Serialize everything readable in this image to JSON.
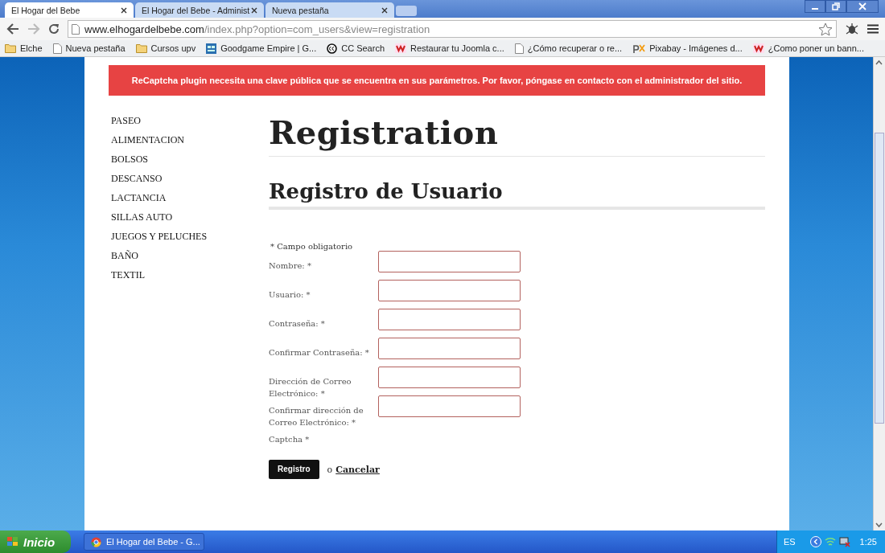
{
  "browser": {
    "tabs": [
      {
        "title": "El Hogar del Bebe",
        "selected": true
      },
      {
        "title": "El Hogar del Bebe - Administ",
        "selected": false
      },
      {
        "title": "Nueva pestaña",
        "selected": false
      }
    ],
    "url_host": "www.elhogardelbebe.com",
    "url_path": "/index.php?option=com_users&view=registration",
    "bookmarks": [
      {
        "label": "Elche",
        "kind": "folder"
      },
      {
        "label": "Nueva pestaña",
        "kind": "page"
      },
      {
        "label": "Cursos upv",
        "kind": "folder"
      },
      {
        "label": "Goodgame Empire | G...",
        "kind": "game"
      },
      {
        "label": "CC Search",
        "kind": "cc"
      },
      {
        "label": "Restaurar tu Joomla c...",
        "kind": "w"
      },
      {
        "label": "¿Cómo recuperar o re...",
        "kind": "page"
      },
      {
        "label": "Pixabay - Imágenes d...",
        "kind": "px"
      },
      {
        "label": "¿Como poner un bann...",
        "kind": "w"
      }
    ]
  },
  "alert": "ReCaptcha plugin necesita una clave pública que se encuentra en sus parámetros. Por favor, póngase en contacto con el administrador del sitio.",
  "sidebar": {
    "items": [
      "PASEO",
      "ALIMENTACION",
      "BOLSOS",
      "DESCANSO",
      "LACTANCIA",
      "SILLAS AUTO",
      "JUEGOS Y PELUCHES",
      "BAÑO",
      "TEXTIL"
    ]
  },
  "page_title": "Registration",
  "section_title": "Registro de Usuario",
  "required_note": "* Campo obligatorio",
  "fields": [
    {
      "label": "Nombre: *",
      "kind": "input"
    },
    {
      "label": "Usuario: *",
      "kind": "input"
    },
    {
      "label": "Contraseña: *",
      "kind": "input"
    },
    {
      "label": "Confirmar Contraseña: *",
      "kind": "input"
    },
    {
      "label": "Dirección de Correo Electrónico: *",
      "kind": "input"
    },
    {
      "label": "Confirmar dirección de Correo Electrónico: *",
      "kind": "input"
    },
    {
      "label": "Captcha *",
      "kind": "empty"
    }
  ],
  "submit": "Registro",
  "or_text": "o",
  "cancel": "Cancelar",
  "taskbar": {
    "start": "Inicio",
    "task": "El Hogar del Bebe - G...",
    "language": "ES",
    "time": "1:25"
  }
}
